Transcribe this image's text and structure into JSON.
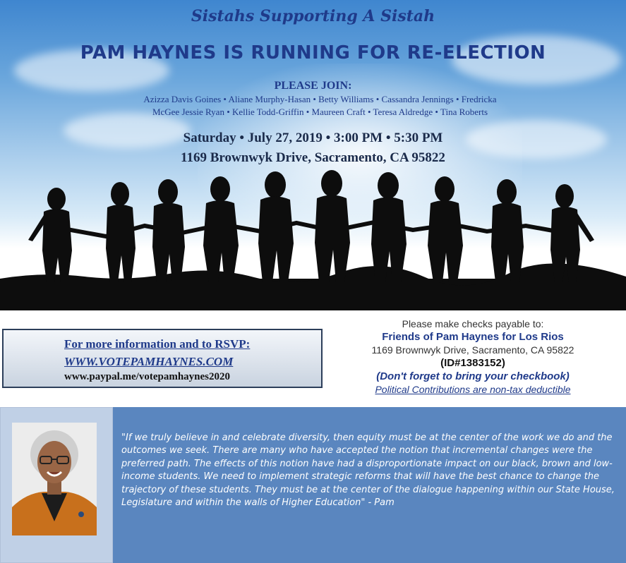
{
  "header": {
    "slogan": "Sistahs Supporting A Sistah",
    "headline": "PAM HAYNES IS RUNNING FOR RE-ELECTION"
  },
  "invite": {
    "title": "PLEASE JOIN:",
    "hosts_line1": "Azizza Davis Goines • Aliane Murphy-Hasan • Betty Williams • Cassandra Jennings • Fredricka",
    "hosts_line2": "McGee Jessie Ryan • Kellie Todd-Griffin • Maureen Craft • Teresa Aldredge • Tina Roberts"
  },
  "event": {
    "when": "Saturday • July 27, 2019 • 3:00 PM • 5:30 PM",
    "where": "1169 Brownwyk Drive, Sacramento, CA  95822"
  },
  "rsvp": {
    "title": "For more information and to RSVP:",
    "website": "WWW.VOTEPAMHAYNES.COM",
    "paypal": "www.paypal.me/votepamhaynes2020"
  },
  "checks": {
    "line1": "Please make checks payable to:",
    "payee": "Friends of Pam Haynes for Los Rios",
    "address": "1169 Brownwyk Drive, Sacramento, CA  95822",
    "id": "(ID#1383152)",
    "reminder": "(Don't forget to bring your checkbook)",
    "disclaimer": "Political Contributions are non-tax deductible"
  },
  "quote": {
    "text": "\"If we truly believe in and celebrate diversity, then equity must be at the center of the work we do and the outcomes we seek. There are many who have accepted the notion that incremental changes were the preferred path. The effects of this notion have had a disproportionate impact on our black, brown and low-income students. We need to implement strategic reforms that will have the best chance to change the trajectory of these students. They must be at the center of the dialogue happening within our State House, Legislature and within the walls of Higher Education\"        - Pam"
  },
  "colors": {
    "accent_navy": "#1f3a8a",
    "quote_panel": "#5a86bf",
    "photo_frame": "#c0d0e6"
  }
}
